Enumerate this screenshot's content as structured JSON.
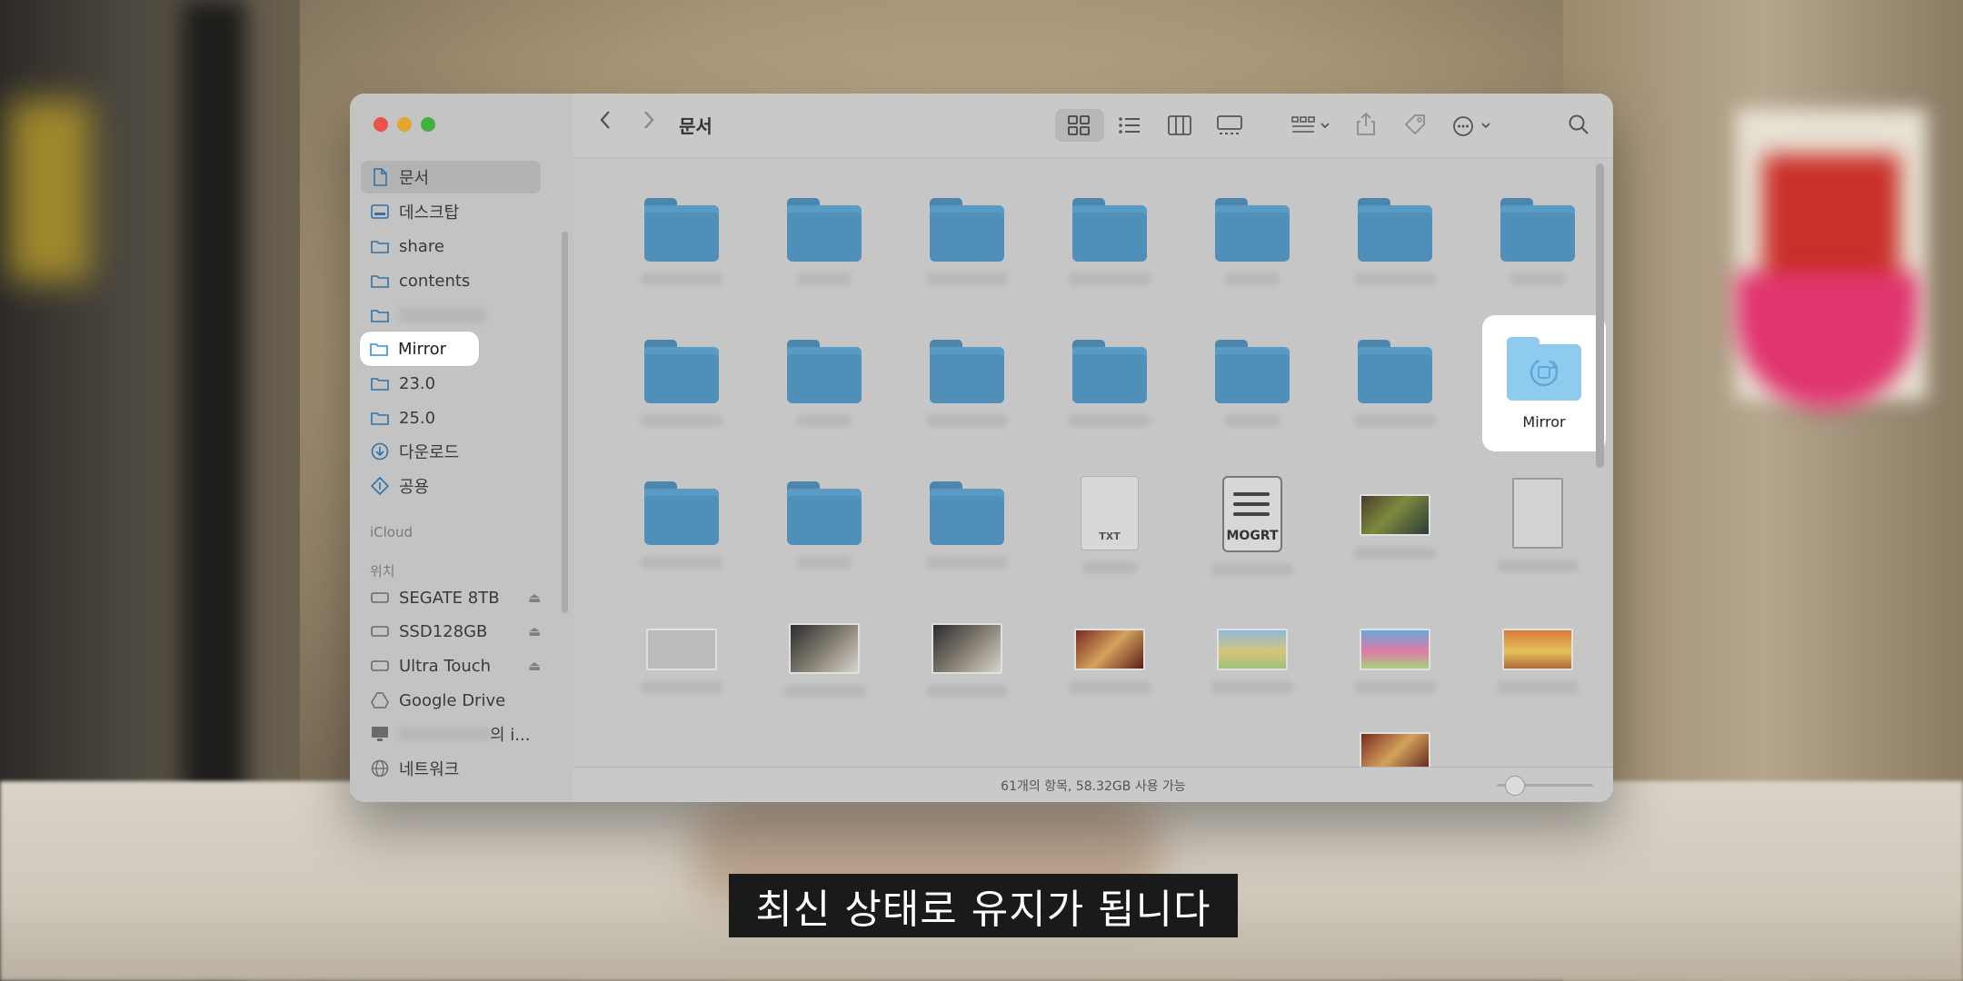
{
  "window": {
    "title": "문서",
    "status": "61개의 항목, 58.32GB 사용 가능"
  },
  "sidebar": {
    "favorites": [
      {
        "label": "문서",
        "icon": "document-icon",
        "active": true
      },
      {
        "label": "데스크탑",
        "icon": "desktop-icon"
      },
      {
        "label": "share",
        "icon": "folder-icon"
      },
      {
        "label": "contents",
        "icon": "folder-icon"
      },
      {
        "label": "",
        "icon": "folder-icon",
        "blurred": true
      },
      {
        "label": "Mirror",
        "icon": "folder-icon",
        "highlight": true
      },
      {
        "label": "23.0",
        "icon": "folder-icon"
      },
      {
        "label": "25.0",
        "icon": "folder-icon"
      },
      {
        "label": "다운로드",
        "icon": "download-icon"
      },
      {
        "label": "공용",
        "icon": "shared-icon"
      }
    ],
    "icloud_header": "iCloud",
    "locations_header": "위치",
    "locations": [
      {
        "label": "SEGATE 8TB",
        "icon": "drive-icon",
        "eject": true
      },
      {
        "label": "SSD128GB",
        "icon": "drive-icon",
        "eject": true
      },
      {
        "label": "Ultra Touch",
        "icon": "drive-icon",
        "eject": true
      },
      {
        "label": "Google Drive",
        "icon": "google-drive-icon"
      },
      {
        "label": "의 i...",
        "icon": "computer-icon",
        "blurred_prefix": true
      },
      {
        "label": "네트워크",
        "icon": "network-icon"
      }
    ]
  },
  "grid": {
    "mirror_label": "Mirror",
    "txt_label": "TXT",
    "mogrt_label": "MOGRT"
  },
  "subtitle": "최신 상태로 유지가 됩니다",
  "colors": {
    "folder": "#4f8fba",
    "mirror_folder": "#8fcbef",
    "close": "#e9534b",
    "minimize": "#e3a52e",
    "zoom": "#41b23a"
  }
}
